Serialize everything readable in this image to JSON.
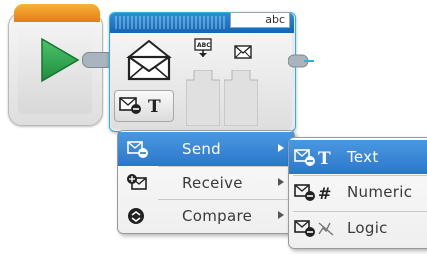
{
  "message_block": {
    "name_value": "abc"
  },
  "mode_menu": {
    "items": [
      {
        "label": "Send",
        "selected": true
      },
      {
        "label": "Receive",
        "selected": false
      },
      {
        "label": "Compare",
        "selected": false
      }
    ]
  },
  "send_submenu": {
    "items": [
      {
        "label": "Text",
        "selected": true
      },
      {
        "label": "Numeric",
        "selected": false
      },
      {
        "label": "Logic",
        "selected": false
      }
    ]
  },
  "colors": {
    "start_accent": "#e88a1a",
    "play_green": "#2ea44f",
    "message_header_blue": "#1d6fc0",
    "selection_blue": "#2f7fd0",
    "focus_cyan": "#27b6d9"
  },
  "icons": {
    "start": "play-icon",
    "block": "envelope-icon",
    "mode": "send-text-mode-icon",
    "text_param": "text-input-icon",
    "message_param": "message-envelope-icon"
  }
}
